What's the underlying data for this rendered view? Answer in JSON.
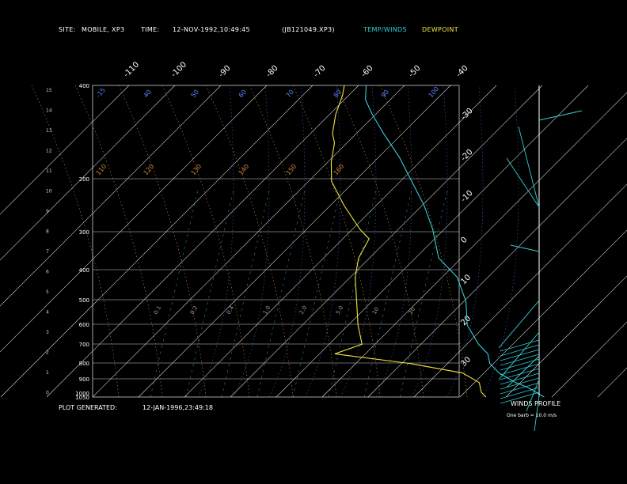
{
  "header": {
    "site_label": "SITE:",
    "site_value": "MOBILE, XP3",
    "time_label": "TIME:",
    "time_value": "12-NOV-1992,10:49:45",
    "file_id": "(JB121049.XP3)",
    "temp_winds_label": "TEMP/WINDS",
    "dewpoint_label": "DEWPOINT"
  },
  "footer": {
    "plot_generated_label": "PLOT GENERATED:",
    "plot_generated_value": "12-JAN-1996,23:49:18",
    "winds_profile_label": "WINDS PROFILE",
    "barb_note": "One barb = 10.0 m/s"
  },
  "colors": {
    "temperature": "#31d0d8",
    "dewpoint": "#f2e640",
    "isotherm": "#d8d8d8",
    "dry_adiabat": "#d08a40",
    "moist_adiabat": "#4060c8",
    "mixing_ratio": "#3fa0a0",
    "grid": "#cfcfcf"
  },
  "chart_data": {
    "type": "line",
    "x_ticks_top": [
      "-110",
      "-100",
      "-90",
      "-80",
      "-70",
      "-60",
      "-50",
      "-40"
    ],
    "temp_ticks_right": [
      "-30",
      "-20",
      "-10",
      "0",
      "10",
      "20",
      "30"
    ],
    "pressure_ticks": [
      "400",
      "200",
      "300",
      "400",
      "500",
      "600",
      "700",
      "800",
      "900",
      "1000",
      "1050"
    ],
    "height_ticks": [
      "15",
      "14",
      "13",
      "12",
      "11",
      "10",
      "9",
      "8",
      "7",
      "6",
      "5",
      "4",
      "3",
      "2",
      "1",
      "0"
    ],
    "dry_adiabat_labels": [
      "-15",
      "40",
      "50",
      "60",
      "70",
      "80",
      "90",
      "100",
      "110",
      "120",
      "130",
      "140",
      "150",
      "160"
    ],
    "mixing_ratio_labels": [
      "0.1",
      "0.2",
      "0.4",
      "1.0",
      "2.0",
      "5.0",
      "10",
      "20"
    ],
    "series": [
      {
        "name": "TEMP/WINDS",
        "points": [
          [
            400,
            -82
          ],
          [
            430,
            -80
          ],
          [
            460,
            -76
          ],
          [
            500,
            -70
          ],
          [
            550,
            -62
          ],
          [
            600,
            -55
          ],
          [
            650,
            -48
          ],
          [
            700,
            -42
          ],
          [
            720,
            -40
          ],
          [
            760,
            -36
          ],
          [
            800,
            -28
          ],
          [
            850,
            -22
          ],
          [
            900,
            -18
          ],
          [
            940,
            -12
          ],
          [
            960,
            -8
          ],
          [
            980,
            -6
          ],
          [
            1000,
            -2
          ],
          [
            1020,
            4
          ],
          [
            1030,
            8
          ],
          [
            1050,
            14
          ]
        ]
      },
      {
        "name": "DEWPOINT",
        "points": [
          [
            400,
            -88
          ],
          [
            420,
            -87
          ],
          [
            460,
            -86
          ],
          [
            500,
            -84
          ],
          [
            520,
            -82
          ],
          [
            560,
            -80
          ],
          [
            600,
            -77
          ],
          [
            650,
            -70
          ],
          [
            700,
            -62
          ],
          [
            720,
            -58
          ],
          [
            760,
            -58
          ],
          [
            800,
            -56
          ],
          [
            850,
            -52
          ],
          [
            900,
            -48
          ],
          [
            940,
            -44
          ],
          [
            960,
            -50
          ],
          [
            980,
            -28
          ],
          [
            1000,
            -12
          ],
          [
            1020,
            -6
          ],
          [
            1040,
            -4
          ],
          [
            1050,
            -2
          ]
        ]
      }
    ]
  }
}
